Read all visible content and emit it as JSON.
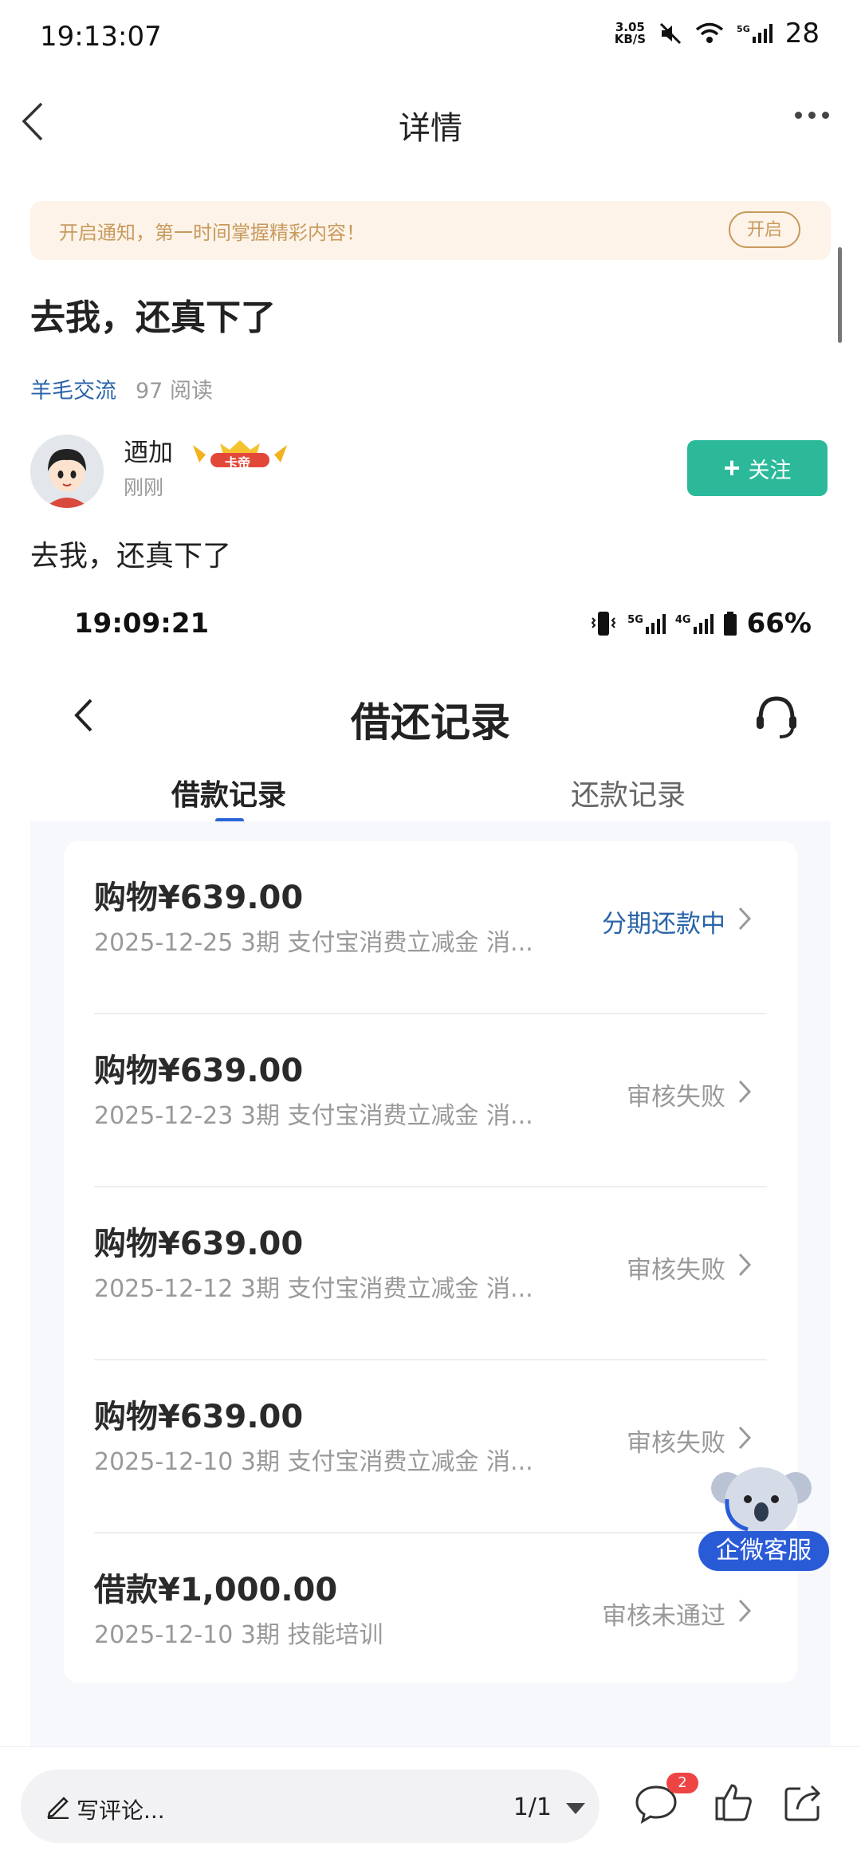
{
  "status_bar": {
    "time": "19:13:07",
    "net_speed_value": "3.05",
    "net_speed_unit": "KB/S",
    "network": "5G",
    "battery": "28"
  },
  "nav": {
    "title": "详情",
    "back_icon": "chevron-left-icon",
    "more_icon": "more-dots-icon"
  },
  "notify": {
    "text": "开启通知，第一时间掌握精彩内容！",
    "button": "开启"
  },
  "post": {
    "title": "去我，还真下了",
    "category": "羊毛交流",
    "reads": "97 阅读",
    "author": "迺加",
    "badge_text": "卡帝",
    "time": "刚刚",
    "follow": "关注",
    "follow_plus": "+",
    "body": "去我，还真下了"
  },
  "embedded": {
    "status_time": "19:09:21",
    "signal_5g": "5G",
    "signal_4g": "4G",
    "battery": "66%",
    "title": "借还记录",
    "tabs": [
      {
        "label": "借款记录",
        "active": true
      },
      {
        "label": "还款记录",
        "active": false
      }
    ],
    "records": [
      {
        "title": "购物¥639.00",
        "sub": "2025-12-25 3期  支付宝消费立减金 消...",
        "status": "分期还款中",
        "active": true
      },
      {
        "title": "购物¥639.00",
        "sub": "2025-12-23 3期  支付宝消费立减金 消...",
        "status": "审核失败",
        "active": false
      },
      {
        "title": "购物¥639.00",
        "sub": "2025-12-12 3期  支付宝消费立减金 消...",
        "status": "审核失败",
        "active": false
      },
      {
        "title": "购物¥639.00",
        "sub": "2025-12-10 3期  支付宝消费立减金 消...",
        "status": "审核失败",
        "active": false
      },
      {
        "title": "借款¥1,000.00",
        "sub": "2025-12-10 3期  技能培训",
        "status": "审核未通过",
        "active": false
      }
    ],
    "customer_service": "企微客服"
  },
  "bottom_bar": {
    "comment_placeholder": "写评论...",
    "page": "1/1",
    "comment_count": "2"
  },
  "colors": {
    "accent_green": "#2bb99a",
    "link_blue": "#2a64a8",
    "notify_bg": "#fdf3e8",
    "notify_text": "#c89a5e",
    "badge_red": "#ef4444"
  }
}
